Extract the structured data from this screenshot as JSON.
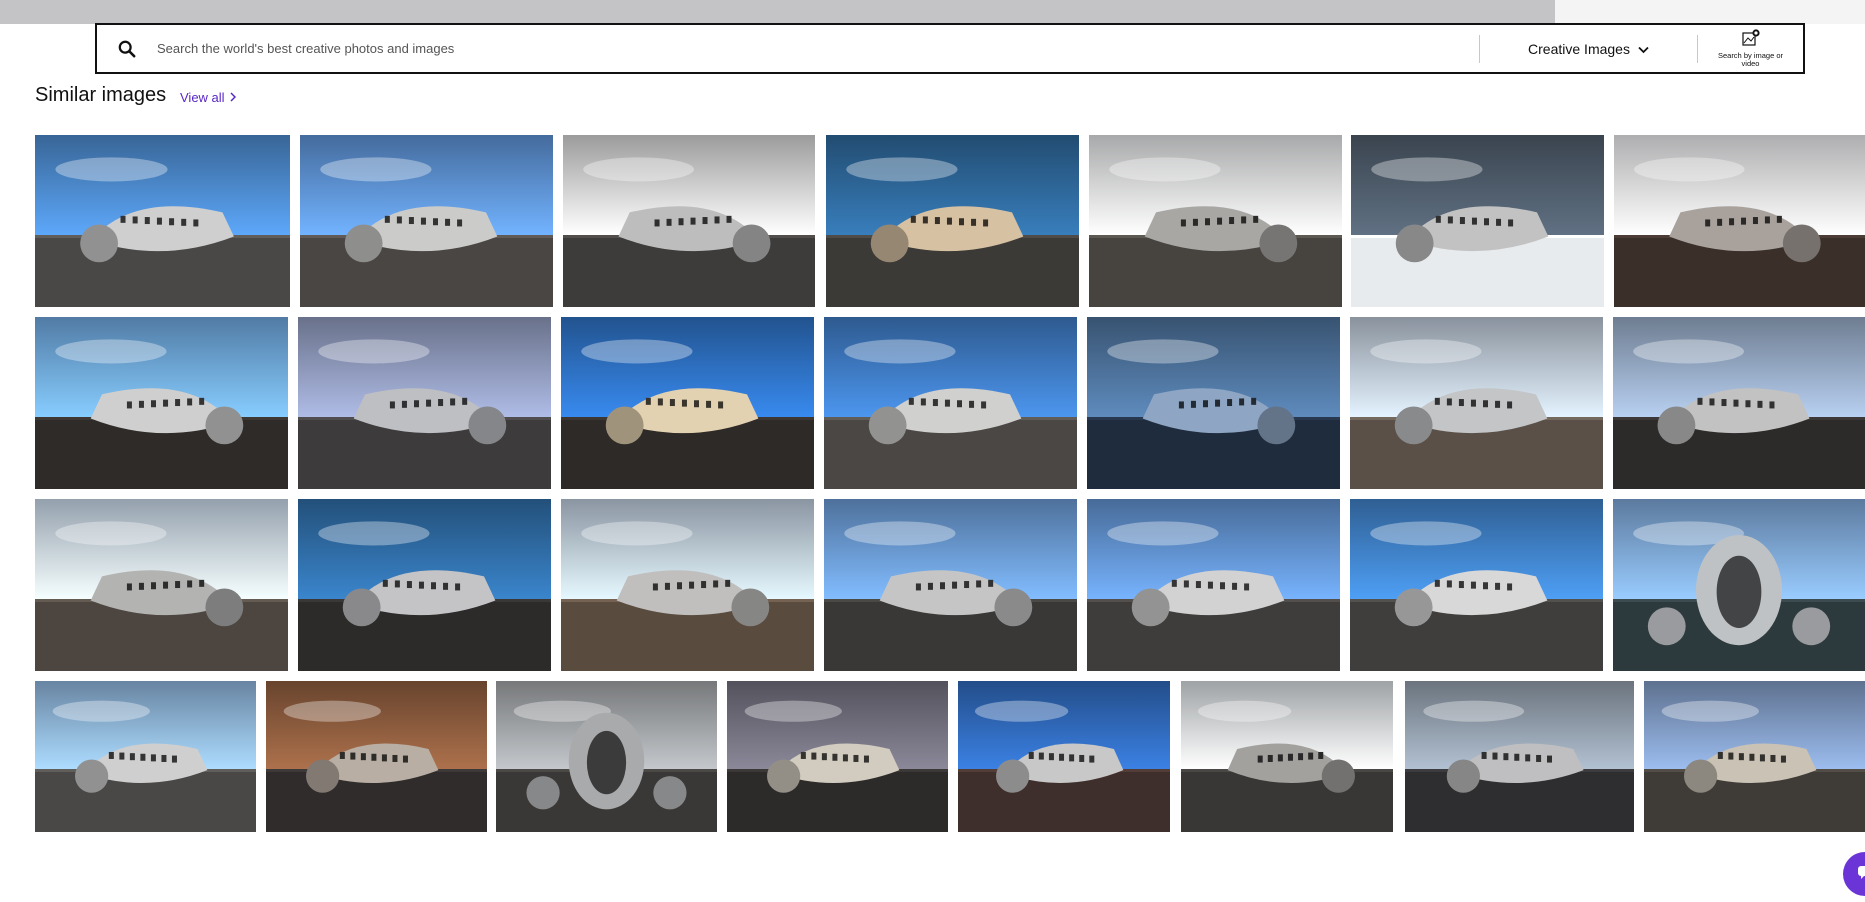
{
  "search": {
    "placeholder": "Search the world's best creative photos and images",
    "value": "",
    "type_label": "Creative Images",
    "visual_search_label": "Search by image or video"
  },
  "similar": {
    "title": "Similar images",
    "view_all_label": "View all"
  },
  "colors": {
    "accent": "#5a27c7",
    "chat_button": "#6a34d6",
    "search_border": "#111111"
  },
  "icons": [
    "search-icon",
    "chevron-down-icon",
    "visual-search-icon",
    "chevron-right-icon",
    "chat-icon"
  ],
  "images": [
    {
      "sky": "#4a86c8",
      "ground": "#4a4846",
      "plane": "#cfcfcf",
      "facing": "right"
    },
    {
      "sky": "#5b8fd1",
      "ground": "#4a4643",
      "plane": "#cbcbc9",
      "facing": "right"
    },
    {
      "sky": "#cfcfd0",
      "ground": "#3e3c3a",
      "plane": "#bdbdbd",
      "facing": "left"
    },
    {
      "sky": "#2d6596",
      "ground": "#3c3a37",
      "plane": "#d6c1a3",
      "facing": "right"
    },
    {
      "sky": "#e0e1e3",
      "ground": "#47443f",
      "plane": "#a8a7a4",
      "facing": "left"
    },
    {
      "sky": "#4d5a69",
      "ground": "#e7ebee",
      "plane": "#c2c2c2",
      "facing": "right"
    },
    {
      "sky": "#e8e8ea",
      "ground": "#3b2f2a",
      "plane": "#a9a29c",
      "facing": "left"
    },
    {
      "sky": "#6ca4dc",
      "ground": "#2f2b28",
      "plane": "#cfcfcf",
      "facing": "left"
    },
    {
      "sky": "#8c96b8",
      "ground": "#3d3b3b",
      "plane": "#bdbfc3",
      "facing": "left"
    },
    {
      "sky": "#2d6ebf",
      "ground": "#2e2a27",
      "plane": "#e3d2b1",
      "facing": "right"
    },
    {
      "sky": "#3d78bf",
      "ground": "#4a4744",
      "plane": "#d0d0ce",
      "facing": "right"
    },
    {
      "sky": "#4b6f97",
      "ground": "#1f2c3d",
      "plane": "#8ea6c4",
      "facing": "left"
    },
    {
      "sky": "#b6c2d1",
      "ground": "#5a5048",
      "plane": "#c3c5c7",
      "facing": "right"
    },
    {
      "sky": "#93a6c1",
      "ground": "#2d2b2a",
      "plane": "#c2c2c2",
      "facing": "right"
    },
    {
      "sky": "#c5d5e6",
      "ground": "#4d4640",
      "plane": "#b3b3b2",
      "facing": "left"
    },
    {
      "sky": "#2e6aa3",
      "ground": "#2c2b2a",
      "plane": "#c4c4c6",
      "facing": "right"
    },
    {
      "sky": "#b8c6d6",
      "ground": "#5a4b3f",
      "plane": "#c0bfbd",
      "facing": "left"
    },
    {
      "sky": "#6897cf",
      "ground": "#3a3836",
      "plane": "#c5c5c5",
      "facing": "left"
    },
    {
      "sky": "#5f8fcb",
      "ground": "#3f3d3b",
      "plane": "#d2d2d2",
      "facing": "right"
    },
    {
      "sky": "#3e7fc4",
      "ground": "#403e3c",
      "plane": "#d8d8d8",
      "facing": "right"
    },
    {
      "sky": "#7aa3d3",
      "ground": "#2d3a3d",
      "plane": "#bfc2c5",
      "facing": "center"
    },
    {
      "sky": "#8ab0d8",
      "ground": "#4a4846",
      "plane": "#cfcfcf",
      "facing": "right"
    },
    {
      "sky": "#8a5a3d",
      "ground": "#2f2c2b",
      "plane": "#b9aea3",
      "facing": "right"
    },
    {
      "sky": "#9da0a3",
      "ground": "#3a3836",
      "plane": "#a9aaac",
      "facing": "center"
    },
    {
      "sky": "#6f6d7a",
      "ground": "#2d2b2a",
      "plane": "#d2cbbf",
      "facing": "right"
    },
    {
      "sky": "#2f67b6",
      "ground": "#3f2f2c",
      "plane": "#c8c8c8",
      "facing": "right"
    },
    {
      "sky": "#d3d8dc",
      "ground": "#393735",
      "plane": "#a3a19e",
      "facing": "left"
    },
    {
      "sky": "#8e9aa8",
      "ground": "#2e2e30",
      "plane": "#bfbfc1",
      "facing": "right"
    },
    {
      "sky": "#7d97bf",
      "ground": "#3f3b36",
      "plane": "#c9c2b5",
      "facing": "right"
    }
  ]
}
